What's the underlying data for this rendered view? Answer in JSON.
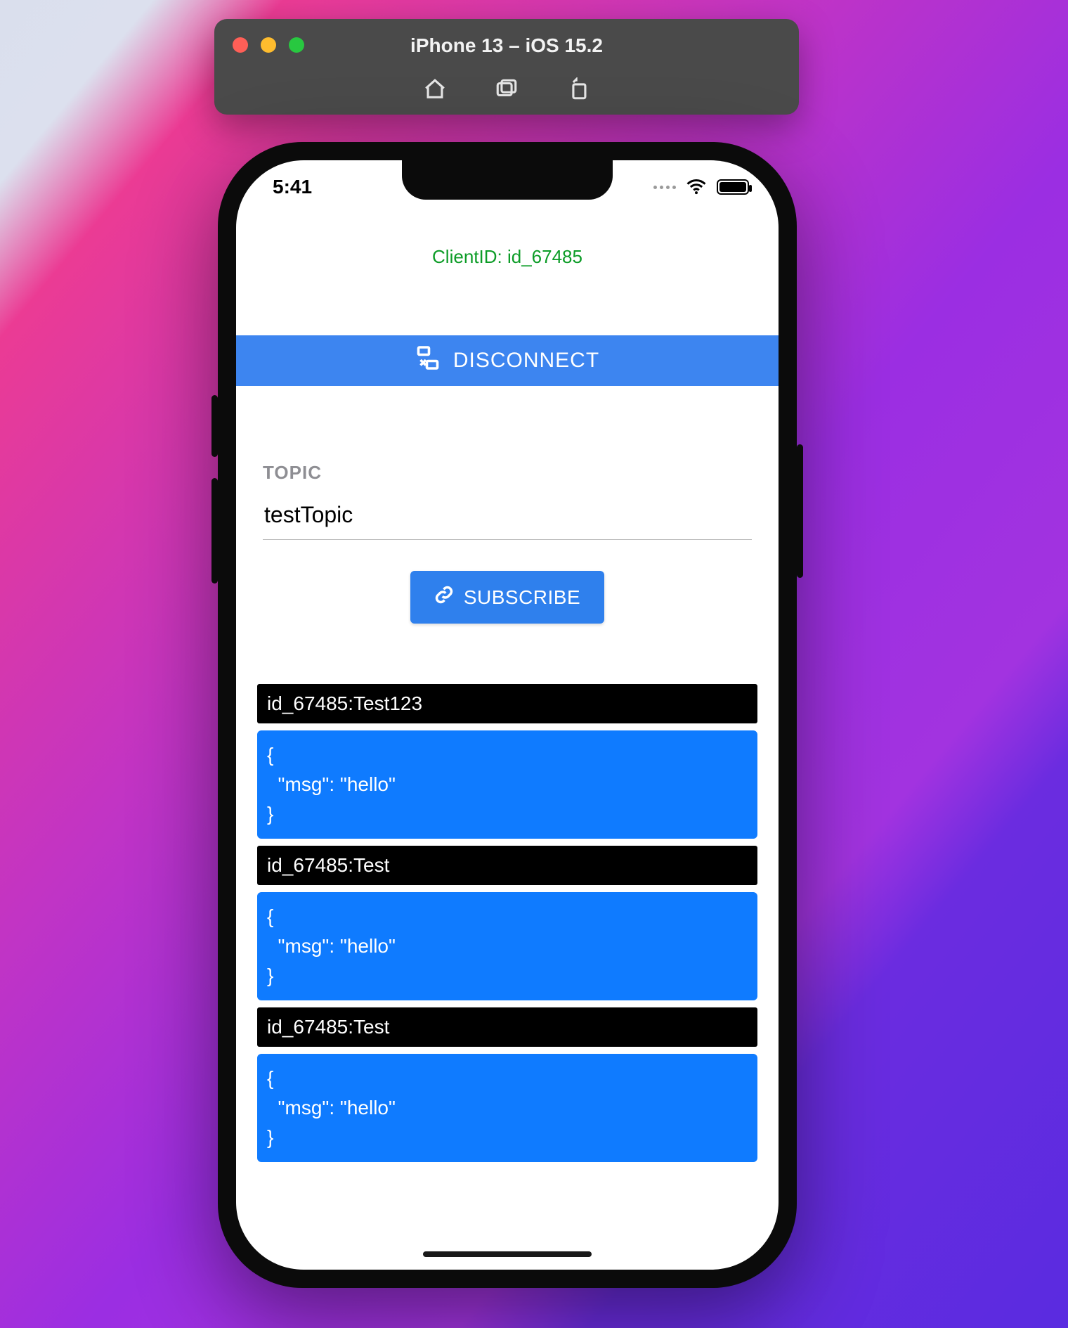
{
  "titlebar": {
    "title": "iPhone 13 – iOS 15.2"
  },
  "statusbar": {
    "time": "5:41"
  },
  "app": {
    "client_id": "ClientID: id_67485",
    "disconnect_label": "DISCONNECT",
    "topic_label": "TOPIC",
    "topic_value": "testTopic",
    "subscribe_label": "SUBSCRIBE",
    "messages": [
      {
        "header": "id_67485:Test123",
        "body": "{\n  \"msg\": \"hello\"\n}"
      },
      {
        "header": "id_67485:Test",
        "body": "{\n  \"msg\": \"hello\"\n}"
      },
      {
        "header": "id_67485:Test",
        "body": "{\n  \"msg\": \"hello\"\n}"
      }
    ]
  }
}
